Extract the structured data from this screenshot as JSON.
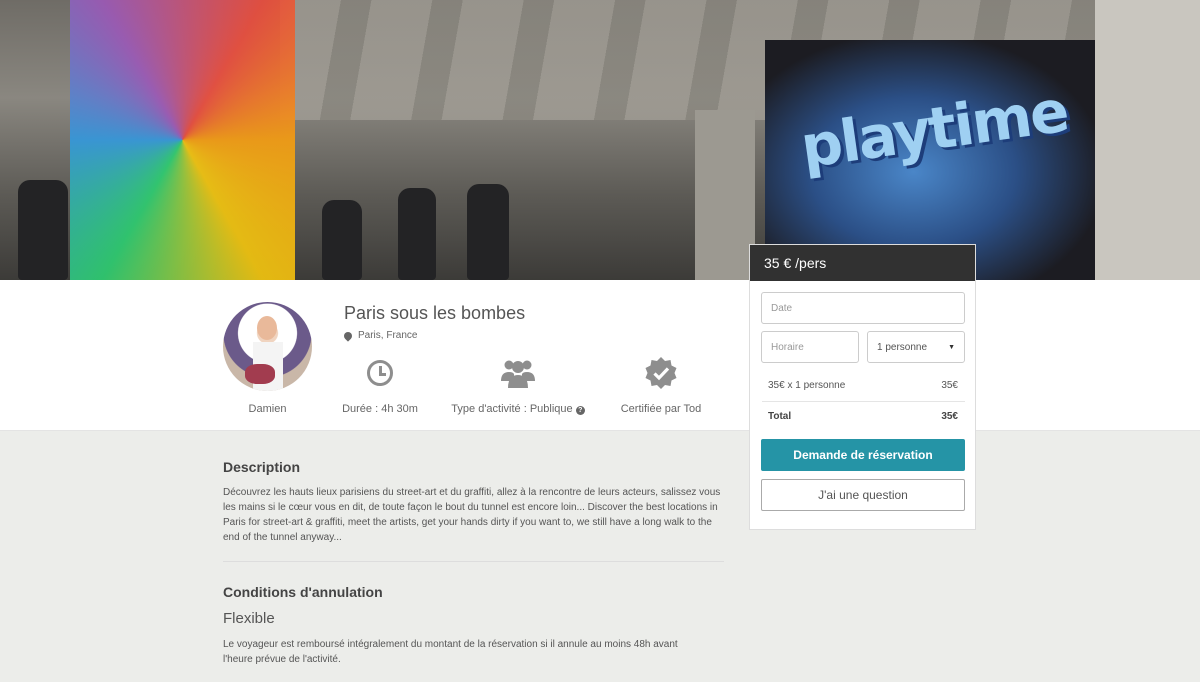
{
  "listing": {
    "title": "Paris sous les bombes",
    "location": "Paris, France",
    "host_name": "Damien"
  },
  "features": [
    {
      "icon": "clock-icon",
      "label": "Durée : 4h 30m"
    },
    {
      "icon": "group-icon",
      "label": "Type d'activité : Publique"
    },
    {
      "icon": "certified-badge-icon",
      "label": "Certifiée par Tod"
    }
  ],
  "booking": {
    "price": "35 € /pers",
    "date_placeholder": "Date",
    "time_placeholder": "Horaire",
    "persons_value": "1 personne",
    "line_label": "35€ x 1 personne",
    "line_amount": "35€",
    "total_label": "Total",
    "total_amount": "35€",
    "request_button": "Demande de réservation",
    "question_button": "J'ai une question"
  },
  "description": {
    "title": "Description",
    "text": "Découvrez les hauts lieux parisiens du street-art et du graffiti, allez à la rencontre de leurs acteurs, salissez vous les mains si le cœur vous en dit, de toute façon le bout du tunnel est encore loin... Discover the best locations in Paris for street-art & graffiti, meet the artists, get your hands dirty if you want to, we still have a long walk to the end of the tunnel anyway..."
  },
  "cancellation": {
    "title": "Conditions d'annulation",
    "policy": "Flexible",
    "text": "Le voyageur est remboursé intégralement du montant de la réservation si il annule au moins 48h avant l'heure prévue de l'activité."
  },
  "hero": {
    "graffiti_text": "playtime"
  },
  "colors": {
    "accent": "#2594a6",
    "price_header": "#313131"
  }
}
